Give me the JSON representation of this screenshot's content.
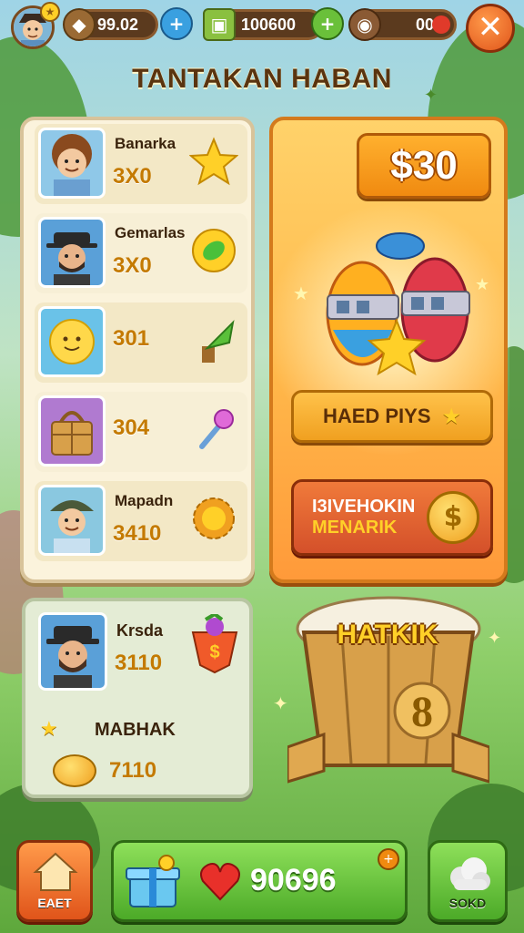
{
  "header": {
    "resources": [
      {
        "name": "coins",
        "value": "99.02"
      },
      {
        "name": "food",
        "value": "100600"
      },
      {
        "name": "wood",
        "value": "00"
      }
    ]
  },
  "title": "TANTAKAN HABAN",
  "list": [
    {
      "name": "Banarka",
      "value": "3X0",
      "icon": "star-icon"
    },
    {
      "name": "Gemarlas",
      "value": "3X0",
      "icon": "leaf-badge-icon"
    },
    {
      "name": "",
      "value": "301",
      "icon": "plant-icon"
    },
    {
      "name": "",
      "value": "304",
      "icon": "lollipop-icon"
    },
    {
      "name": "Mapadn",
      "value": "3410",
      "icon": "sun-gear-icon"
    }
  ],
  "offer": {
    "price": "$30",
    "primary_button": "HAED PIYS",
    "secondary_button_line1": "I3IVEHOKIN",
    "secondary_button_line2": "MENARIK"
  },
  "bottom_panel": {
    "name": "Krsda",
    "value": "3110",
    "label": "MABHAK",
    "coin_value": "7110"
  },
  "crate": {
    "banner": "HATKIK",
    "count": "8"
  },
  "nav": {
    "left_label": "EAET",
    "center_value": "90696",
    "right_label": "SOKD"
  },
  "colors": {
    "accent_orange": "#f08a10",
    "panel_cream": "#fbf3dc",
    "nav_green": "#5cbf3a"
  }
}
